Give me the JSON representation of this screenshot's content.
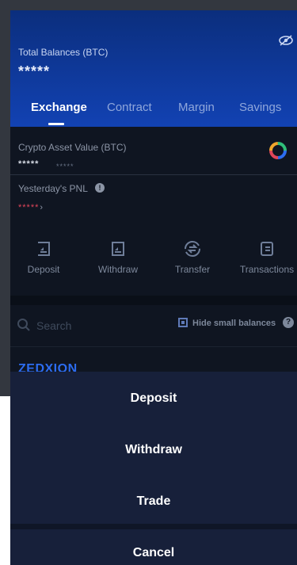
{
  "header": {
    "title": "Total Balances (BTC)",
    "masked_balance": "*****",
    "tabs": [
      {
        "label": "Exchange",
        "active": true
      },
      {
        "label": "Contract",
        "active": false
      },
      {
        "label": "Margin",
        "active": false
      },
      {
        "label": "Savings",
        "active": false
      }
    ],
    "accent_color": "#1242b3"
  },
  "crypto_asset": {
    "title": "Crypto Asset Value (BTC)",
    "masked_value": "*****",
    "masked_sub": "*****"
  },
  "pnl": {
    "title": "Yesterday's PNL",
    "info_icon": "!",
    "masked_value": "*****",
    "arrow": "›",
    "color": "#e0455a"
  },
  "actions": [
    {
      "label": "Deposit",
      "icon": "deposit-icon"
    },
    {
      "label": "Withdraw",
      "icon": "withdraw-icon"
    },
    {
      "label": "Transfer",
      "icon": "transfer-icon"
    },
    {
      "label": "Transactions",
      "icon": "transactions-icon"
    }
  ],
  "search": {
    "placeholder": "Search",
    "hide_small_label": "Hide small balances",
    "help_icon": "?",
    "hide_small_checked": true
  },
  "brand": "ZEDXION",
  "sheet": {
    "options": [
      "Deposit",
      "Withdraw",
      "Trade"
    ],
    "cancel": "Cancel"
  }
}
